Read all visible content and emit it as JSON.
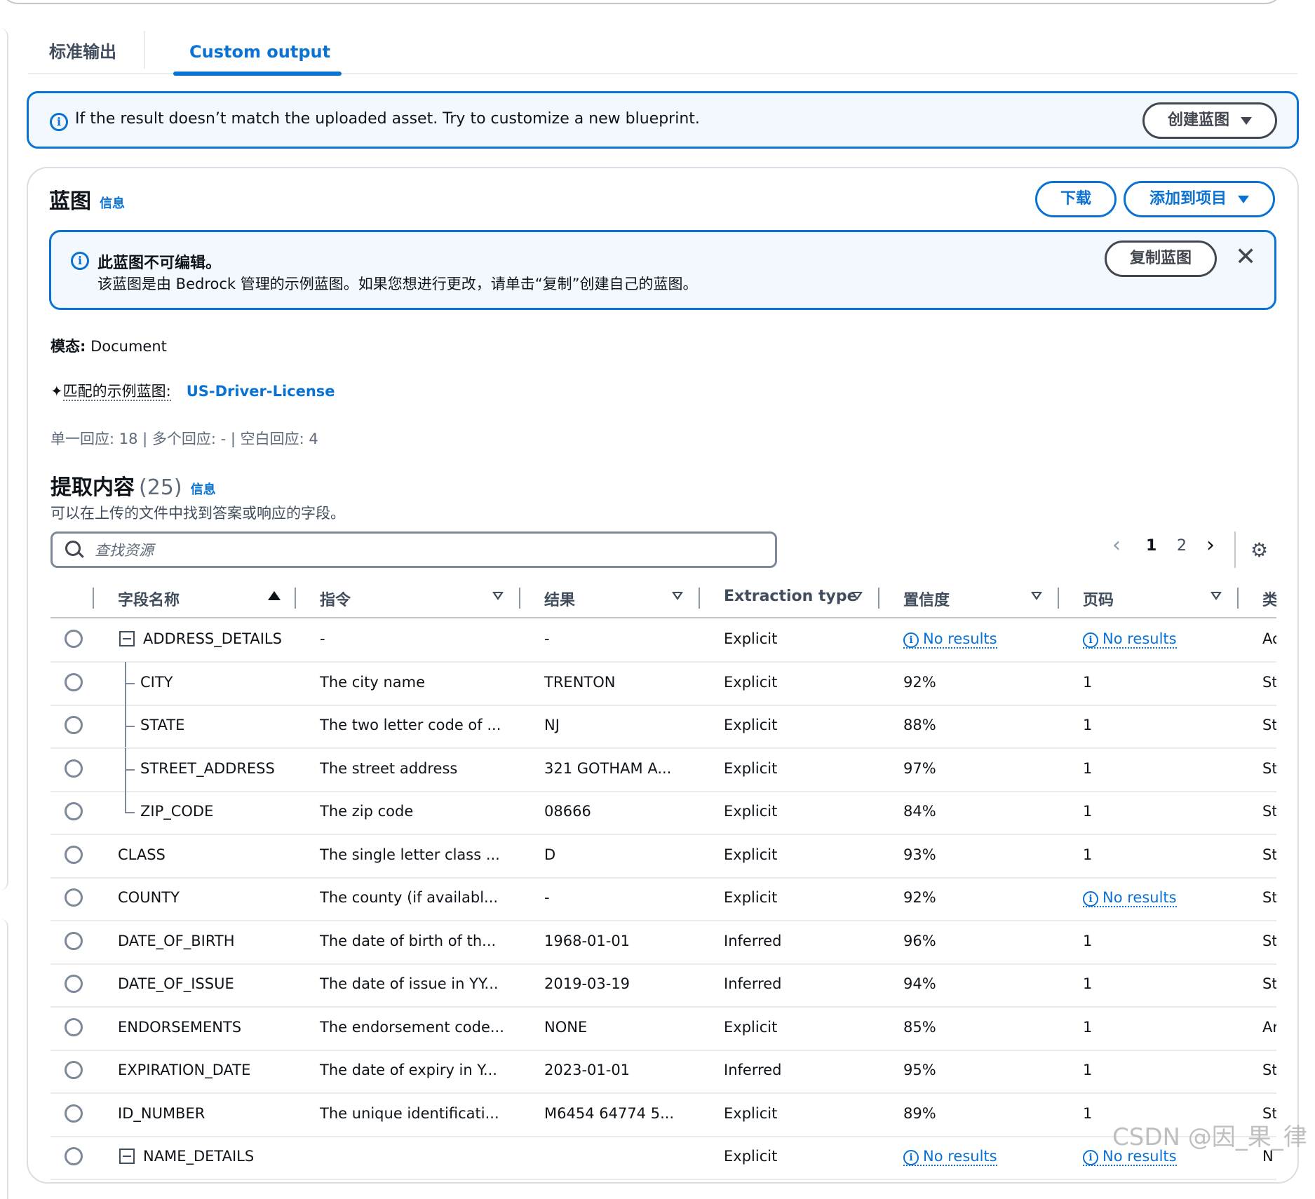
{
  "tabs": {
    "standard": "标准输出",
    "custom": "Custom output"
  },
  "flash_top": {
    "message": "If the result doesn’t match the uploaded asset. Try to customize a new blueprint.",
    "create_label": "创建蓝图"
  },
  "blueprint": {
    "title": "蓝图",
    "info": "信息",
    "download": "下载",
    "add_to_project": "添加到项目",
    "notice_title": "此蓝图不可编辑。",
    "notice_body": "该蓝图是由 Bedrock 管理的示例蓝图。如果您想进行更改，请单击“复制”创建自己的蓝图。",
    "copy": "复制蓝图",
    "modality_label": "模态:",
    "modality_value": "Document",
    "match_label": "匹配的示例蓝图:",
    "match_value": "US-Driver-License",
    "stats": "单一回应: 18 | 多个回应: - | 空白回应: 4"
  },
  "extract": {
    "title": "提取内容",
    "count": "(25)",
    "info": "信息",
    "description": "可以在上传的文件中找到答案或响应的字段。",
    "search_placeholder": "查找资源",
    "pages": [
      "1",
      "2"
    ],
    "columns": [
      "字段名称",
      "指令",
      "结果",
      "Extraction type",
      "置信度",
      "页码",
      "类"
    ],
    "no_results": "No results",
    "rows": [
      {
        "name": "ADDRESS_DETAILS",
        "instruction": "-",
        "result": "-",
        "type": "Explicit",
        "confidence": "No results",
        "page": "No results",
        "cls": "Ac"
      },
      {
        "name": "CITY",
        "instruction": "The city name",
        "result": "TRENTON",
        "type": "Explicit",
        "confidence": "92%",
        "page": "1",
        "cls": "St"
      },
      {
        "name": "STATE",
        "instruction": "The two letter code of ...",
        "result": "NJ",
        "type": "Explicit",
        "confidence": "88%",
        "page": "1",
        "cls": "St"
      },
      {
        "name": "STREET_ADDRESS",
        "instruction": "The street address",
        "result": "321 GOTHAM A...",
        "type": "Explicit",
        "confidence": "97%",
        "page": "1",
        "cls": "St"
      },
      {
        "name": "ZIP_CODE",
        "instruction": "The zip code",
        "result": "08666",
        "type": "Explicit",
        "confidence": "84%",
        "page": "1",
        "cls": "St"
      },
      {
        "name": "CLASS",
        "instruction": "The single letter class ...",
        "result": "D",
        "type": "Explicit",
        "confidence": "93%",
        "page": "1",
        "cls": "St"
      },
      {
        "name": "COUNTY",
        "instruction": "The county (if availabl...",
        "result": "-",
        "type": "Explicit",
        "confidence": "92%",
        "page": "No results",
        "cls": "St"
      },
      {
        "name": "DATE_OF_BIRTH",
        "instruction": "The date of birth of th...",
        "result": "1968-01-01",
        "type": "Inferred",
        "confidence": "96%",
        "page": "1",
        "cls": "St"
      },
      {
        "name": "DATE_OF_ISSUE",
        "instruction": "The date of issue in YY...",
        "result": "2019-03-19",
        "type": "Inferred",
        "confidence": "94%",
        "page": "1",
        "cls": "St"
      },
      {
        "name": "ENDORSEMENTS",
        "instruction": "The endorsement code...",
        "result": "NONE",
        "type": "Explicit",
        "confidence": "85%",
        "page": "1",
        "cls": "Ar"
      },
      {
        "name": "EXPIRATION_DATE",
        "instruction": "The date of expiry in Y...",
        "result": "2023-01-01",
        "type": "Inferred",
        "confidence": "95%",
        "page": "1",
        "cls": "St"
      },
      {
        "name": "ID_NUMBER",
        "instruction": "The unique identificati...",
        "result": "M6454 64774 5...",
        "type": "Explicit",
        "confidence": "89%",
        "page": "1",
        "cls": "St"
      },
      {
        "name": "NAME_DETAILS",
        "instruction": "",
        "result": "",
        "type": "Explicit",
        "confidence": "No results",
        "page": "No results",
        "cls": "N"
      }
    ]
  },
  "watermark": "CSDN @因_果_律",
  "colors": {
    "accent": "#0972d3",
    "text": "#0f141a",
    "muted": "#5f6b7a",
    "info_bg": "#f2f8fd"
  },
  "icons": [
    "info-icon",
    "caret-down-icon",
    "close-icon",
    "sparkle-icon",
    "search-icon",
    "chevron-left-icon",
    "chevron-right-icon",
    "gear-icon",
    "sort-ascending-icon",
    "filter-icon",
    "collapse-icon",
    "radio-icon"
  ]
}
